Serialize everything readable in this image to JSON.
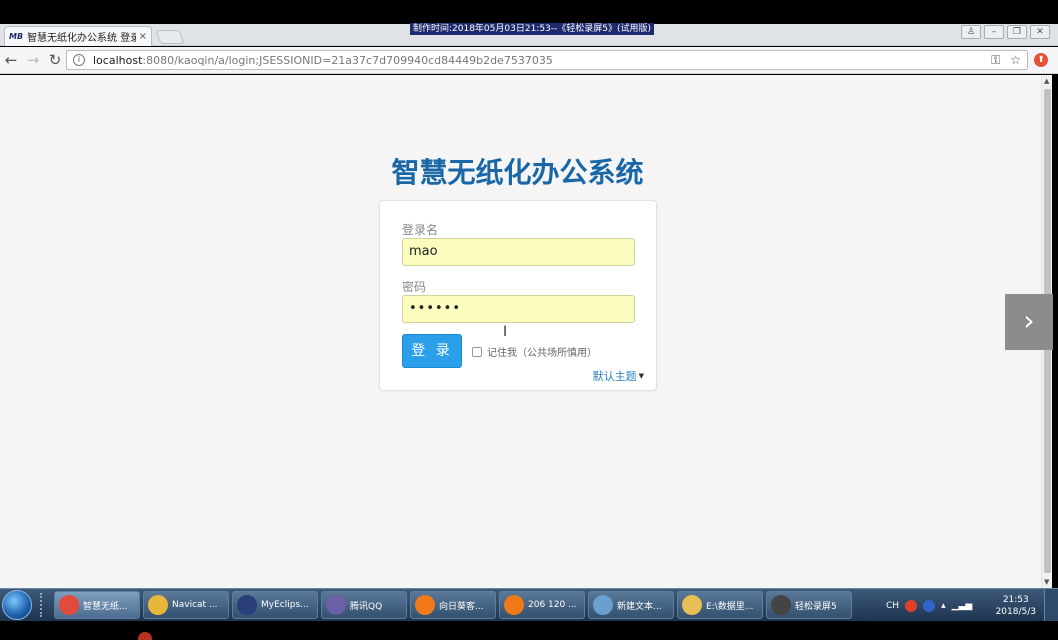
{
  "recorder": {
    "watermark": "制作时间:2018年05月03日21:53--《轻松录屏5》(试用版)"
  },
  "browser": {
    "tab": {
      "favicon": "MB",
      "title": "智慧无纸化办公系统 登录",
      "close": "×"
    },
    "window_buttons": [
      "♙",
      "–",
      "❐",
      "✕"
    ],
    "url_host": "localhost",
    "url_rest": ":8080/kaoqin/a/login;JSESSIONID=21a37c7d709940cd84449b2de7537035",
    "icons": {
      "back": "back-arrow-icon",
      "forward": "forward-arrow-icon",
      "reload": "reload-icon",
      "info": "info-icon",
      "key": "key-icon",
      "star": "star-icon",
      "extension": "extension-icon"
    }
  },
  "page": {
    "title": "智慧无纸化办公系统",
    "username_label": "登录名",
    "username_value": "mao",
    "password_label": "密码",
    "password_value": "••••••",
    "login_button": "登 录",
    "remember_label": "记住我（公共场所慎用）",
    "theme_link": "默认主题"
  },
  "taskbar": {
    "items": [
      {
        "label": "智慧无纸...",
        "icon_color": "#e24a3b"
      },
      {
        "label": "Navicat ...",
        "icon_color": "#e8b73a"
      },
      {
        "label": "MyEclips...",
        "icon_color": "#2a3f7a"
      },
      {
        "label": "腾讯QQ",
        "icon_color": "#6b5fa8"
      },
      {
        "label": "向日葵客...",
        "icon_color": "#f07a1a"
      },
      {
        "label": "206 120 ...",
        "icon_color": "#f07a1a"
      },
      {
        "label": "新建文本...",
        "icon_color": "#6aa0d0"
      },
      {
        "label": "E:\\数据里...",
        "icon_color": "#e6c054"
      },
      {
        "label": "轻松录屏5",
        "icon_color": "#444444"
      }
    ],
    "tray": {
      "lang": "CH",
      "time": "21:53",
      "date": "2018/5/3"
    }
  }
}
